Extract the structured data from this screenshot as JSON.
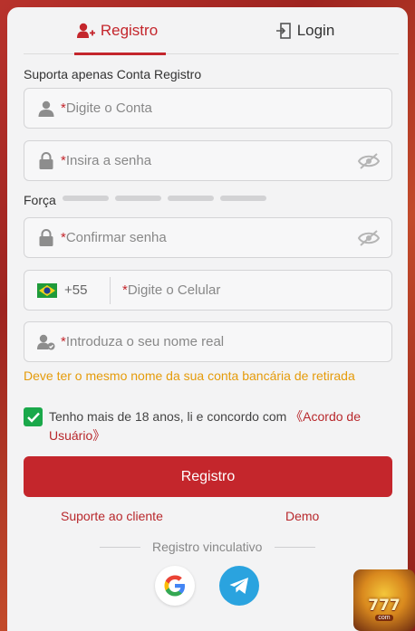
{
  "tabs": {
    "register": "Registro",
    "login": "Login"
  },
  "support_note": "Suporta apenas Conta Registro",
  "fields": {
    "account_placeholder": "Digite o Conta",
    "password_placeholder": "Insira a senha",
    "confirm_placeholder": "Confirmar senha",
    "phone_code": "+55",
    "phone_placeholder": "Digite o Celular",
    "realname_placeholder": "Introduza o seu nome real",
    "required_mark": "*"
  },
  "strength_label": "Força",
  "warning": "Deve ter o mesmo nome da sua conta bancária de retirada",
  "agreement": {
    "text": "Tenho mais de 18 anos, li e concordo com ",
    "link": "《Acordo de Usuário》"
  },
  "register_button": "Registro",
  "links": {
    "support": "Suporte ao cliente",
    "demo": "Demo"
  },
  "divider": "Registro vinculativo",
  "promo": {
    "brand": "777",
    "domain": "com"
  },
  "colors": {
    "accent": "#c4262c",
    "warning": "#e59b0a",
    "check": "#1aa84a",
    "telegram": "#2aa3df"
  },
  "icons": [
    "add-user-icon",
    "login-door-icon",
    "user-icon",
    "lock-icon",
    "eye-off-icon",
    "brazil-flag-icon",
    "verified-user-icon",
    "check-icon",
    "google-icon",
    "telegram-icon"
  ]
}
